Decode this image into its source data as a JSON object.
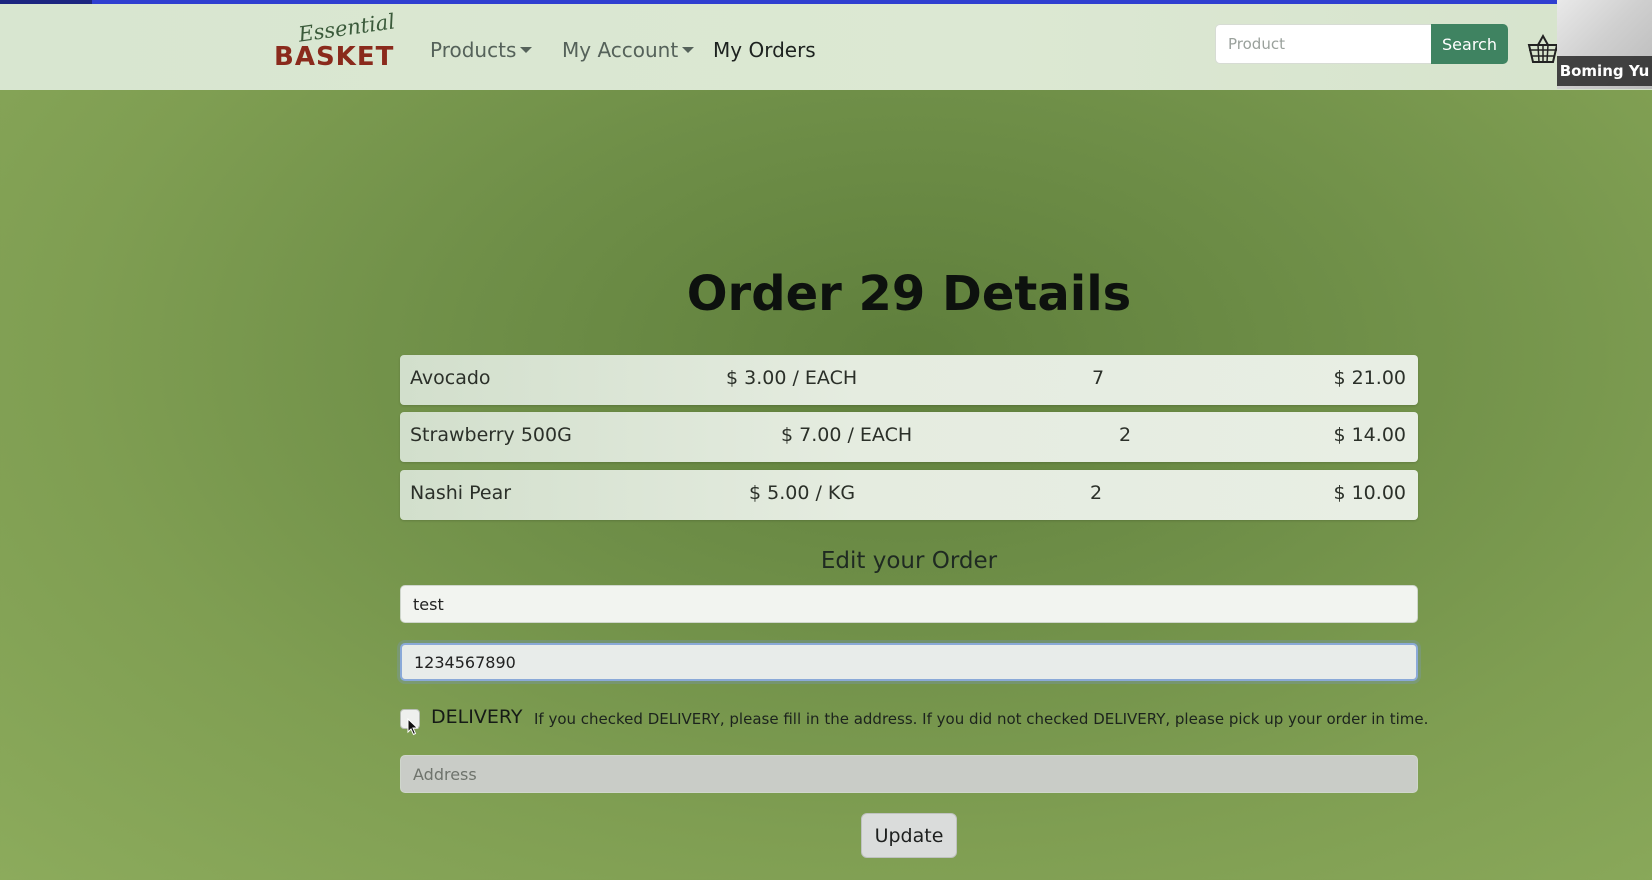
{
  "header": {
    "logo_script": "Essential",
    "logo_brand": "BASKET",
    "nav": {
      "products": "Products",
      "my_account": "My Account",
      "my_orders": "My Orders"
    },
    "search": {
      "placeholder": "Product",
      "button": "Search"
    },
    "basket_icon": "basket-icon"
  },
  "video_overlay": {
    "name": "Boming Yu"
  },
  "order": {
    "title": "Order 29 Details",
    "items": [
      {
        "name": "Avocado",
        "price": "$ 3.00 / EACH",
        "qty": "7",
        "total": "$ 21.00"
      },
      {
        "name": "Strawberry 500G",
        "price": "$ 7.00 / EACH",
        "qty": "2",
        "total": "$ 14.00"
      },
      {
        "name": "Nashi Pear",
        "price": "$ 5.00 / KG",
        "qty": "2",
        "total": "$ 10.00"
      }
    ]
  },
  "edit": {
    "title": "Edit your Order",
    "name_value": "test",
    "phone_value": "1234567890",
    "delivery_label": "DELIVERY",
    "delivery_checked": false,
    "delivery_help": "If you checked DELIVERY, please fill in the address. If you did not checked DELIVERY, please pick up your order in time.",
    "address_placeholder": "Address",
    "update_button": "Update"
  },
  "colors": {
    "accent": "#3f8361",
    "logo_brand": "#8a2a1c",
    "top_bar": "#2f3fd0"
  }
}
